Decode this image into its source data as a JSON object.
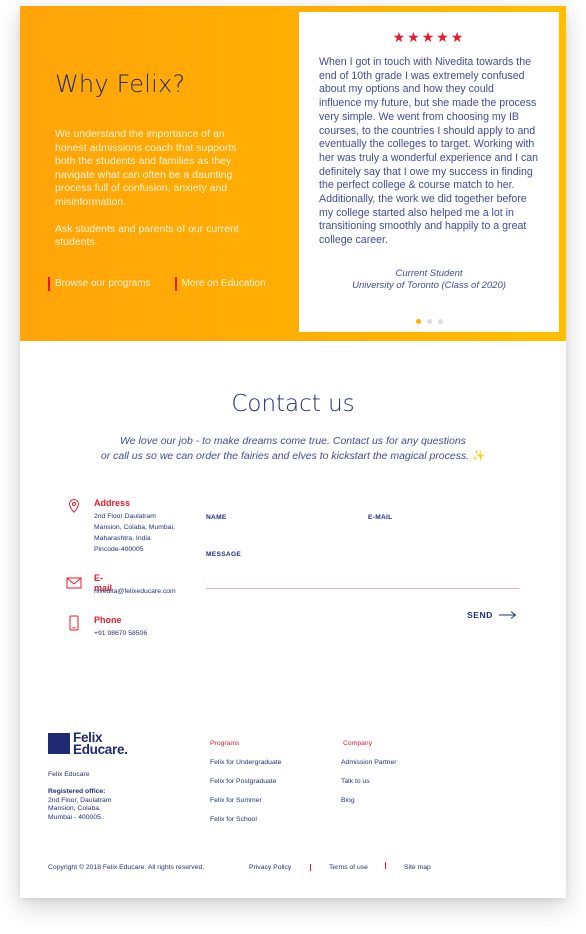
{
  "hero": {
    "title": "Why Felix?",
    "paragraph1": "We understand the importance of an honest admissions coach that supports both the students and families as they navigate what can often be a daunting process full of confusion, anxiety and misinformation.",
    "paragraph2": "Ask students and parents of our current students.",
    "links": [
      "Browse our programs",
      "More on Education"
    ]
  },
  "testimonial": {
    "stars": "★★★★★",
    "quote": "When I got in touch with Nivedita towards the end of 10th grade I was extremely confused about my options and how they could influence my future, but she made the process very simple. We went from choosing my IB courses, to the countries I should apply to and eventually the colleges to target. Working with her was truly a wonderful experience and I can definitely say that I owe my success in finding the perfect college & course match to her. Additionally, the work we did together before my college started also helped me a lot in transitioning smoothly and happily to a great college career.",
    "author_role": "Current Student",
    "author_school": "University of Toronto (Class of 2020)",
    "slide_count": 3,
    "active_slide": 1
  },
  "contact": {
    "title": "Contact us",
    "subtitle_line1": "We love our job - to make dreams come true. Contact us for any questions",
    "subtitle_line2": "or call us so we can order the fairies and elves to kickstart the magical process.",
    "address_label": "Address",
    "address_lines": [
      "2nd Floor Daulatram",
      "Mansion, Colaba, Mumbai,",
      "Maharashtra, India",
      "Pincode-400005"
    ],
    "email_label": "E-mail",
    "email_value": "nivedita@felixeducare.com",
    "phone_label": "Phone",
    "phone_value": "+91 98670 58506",
    "form": {
      "name_label": "NAME",
      "email_label": "E-MAIL",
      "message_label": "MESSAGE",
      "send_label": "SEND"
    }
  },
  "footer": {
    "logo_line1": "Felix",
    "logo_line2": "Educare.",
    "company_name": "Felix Educare",
    "registered_label": "Registered office:",
    "registered_lines": [
      "2nd Floor, Daulatram",
      "Mansion, Colaba,",
      "Mumbai - 400005."
    ],
    "programs_heading": "Programs",
    "programs": [
      "Felix for Undergraduate",
      "Felix for Postgraduate",
      "Felix for Summer",
      "Felix for School"
    ],
    "company_heading": "Company",
    "company_links": [
      "Admission Partner",
      "Talk to us",
      "Blog"
    ],
    "copyright": "Copyright © 2018 Felix Educare. All rights reserved.",
    "legal_links": [
      "Privacy Policy",
      "Terms of use",
      "Site map"
    ]
  },
  "colors": {
    "brand_navy": "#1f2a73",
    "accent_red": "#e8192c",
    "hero_orange": "#ffa40a",
    "hero_yellow": "#ffbf00"
  }
}
